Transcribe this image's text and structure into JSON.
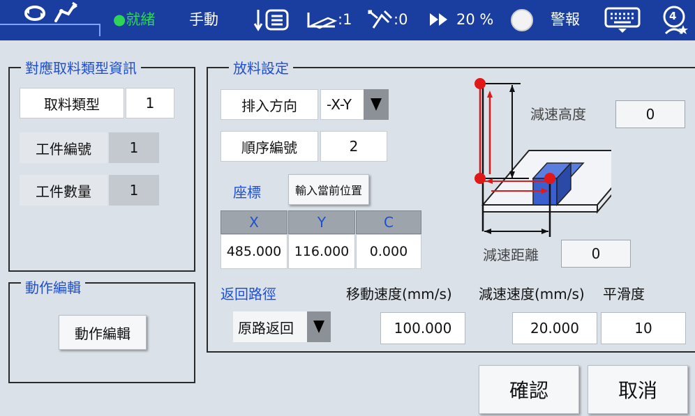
{
  "status_bar": {
    "status": "●就緒",
    "mode": "手動",
    "tool_count": ":1",
    "coord_count": ":0",
    "speed_percent": "20 %",
    "alarm": "警報",
    "user_level": "4",
    "status_color": "#2fd35a"
  },
  "group_pick_info": {
    "title": "對應取料類型資訊",
    "pick_type_label": "取料類型",
    "pick_type_value": "1",
    "workpiece_no_label": "工件編號",
    "workpiece_no_value": "1",
    "workpiece_qty_label": "工件數量",
    "workpiece_qty_value": "1"
  },
  "group_action_edit": {
    "title": "動作編輯",
    "button_label": "動作編輯"
  },
  "group_place_settings": {
    "title": "放料設定",
    "insert_direction_label": "排入方向",
    "insert_direction_value": "-X-Y",
    "sequence_no_label": "順序編號",
    "sequence_no_value": "2",
    "coords_label": "座標",
    "input_current_pos_button": "輸入當前位置",
    "coord_table": {
      "headers": [
        "X",
        "Y",
        "C"
      ],
      "values": [
        "485.000",
        "116.000",
        "0.000"
      ]
    },
    "decel_height_label": "減速高度",
    "decel_height_value": "0",
    "decel_distance_label": "減速距離",
    "decel_distance_value": "0",
    "return_path_label": "返回路徑",
    "return_path_value": "原路返回",
    "move_speed_label": "移動速度(mm/s)",
    "move_speed_value": "100.000",
    "decel_speed_label": "減速速度(mm/s)",
    "decel_speed_value": "20.000",
    "smoothness_label": "平滑度",
    "smoothness_value": "10"
  },
  "footer": {
    "confirm_label": "確認",
    "cancel_label": "取消"
  },
  "colors": {
    "topbar": "#1a3da0",
    "accent_text": "#1f4fd1",
    "diagram_red": "#e01818",
    "block_blue": "#3a5fcf"
  }
}
